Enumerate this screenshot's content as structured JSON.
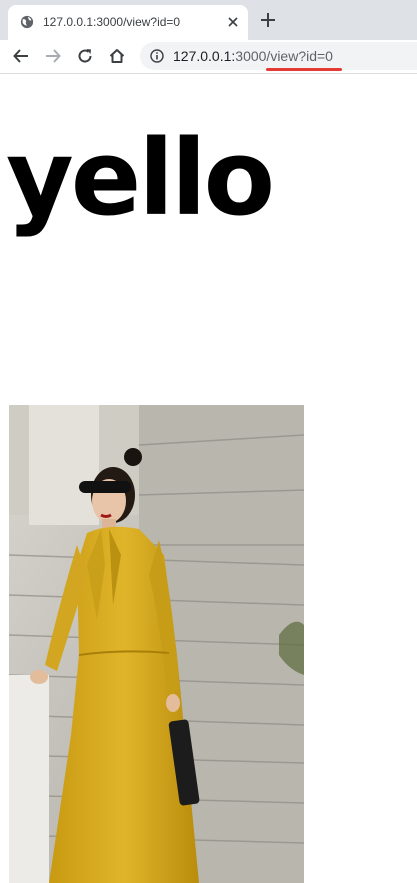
{
  "browser": {
    "tab": {
      "title": "127.0.0.1:3000/view?id=0",
      "favicon": "globe-icon",
      "close_icon": "close-icon"
    },
    "new_tab_icon": "plus-icon",
    "toolbar": {
      "back_icon": "arrow-left-icon",
      "forward_icon": "arrow-right-icon",
      "reload_icon": "reload-icon",
      "home_icon": "home-icon",
      "site_info_icon": "info-icon"
    },
    "address_bar": {
      "host": "127.0.0.1:",
      "path": "3000/view?id=0",
      "highlight_color": "#e53935"
    }
  },
  "page": {
    "heading": "yello",
    "image": {
      "subject": "woman in long mustard-yellow dress on stone stairs",
      "dress_color": "#d9ad1f"
    }
  }
}
